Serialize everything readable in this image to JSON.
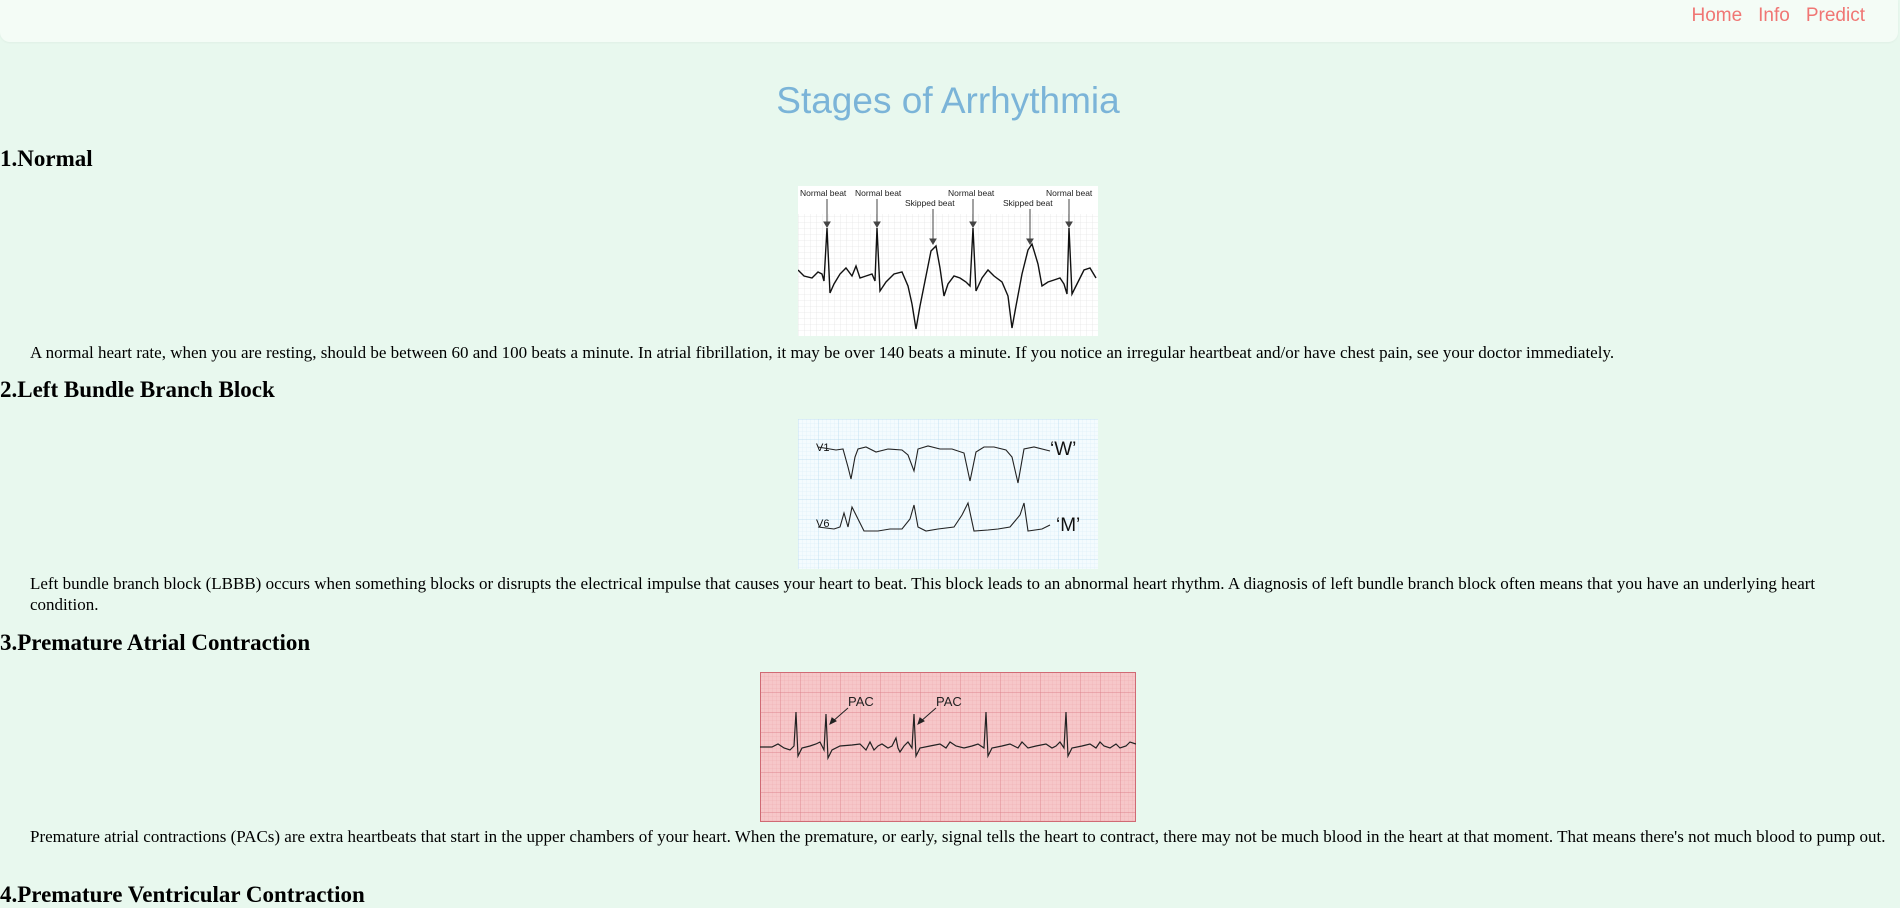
{
  "nav": {
    "items": [
      "Home",
      "Info",
      "Predict"
    ],
    "link_color": "#f07674"
  },
  "page": {
    "title": "Stages of Arrhythmia",
    "title_color": "#7bb4d8",
    "background": "#e8f8ee"
  },
  "sections": [
    {
      "heading": "1.Normal",
      "image_labels": [
        "Normal beat",
        "Normal beat",
        "Skipped beat",
        "Normal beat",
        "Skipped beat",
        "Normal beat"
      ],
      "text": "A normal heart rate, when you are resting, should be between 60 and 100 beats a minute. In atrial fibrillation, it may be over 140 beats a minute. If you notice an irregular heartbeat and/or have chest pain, see your doctor immediately."
    },
    {
      "heading": "2.Left Bundle Branch Block",
      "image_labels": [
        "V1",
        "V6",
        "‘W’",
        "‘M’"
      ],
      "text": "Left bundle branch block (LBBB) occurs when something blocks or disrupts the electrical impulse that causes your heart to beat. This block leads to an abnormal heart rhythm. A diagnosis of left bundle branch block often means that you have an underlying heart condition."
    },
    {
      "heading": "3.Premature Atrial Contraction",
      "image_labels": [
        "PAC",
        "PAC"
      ],
      "text": "Premature atrial contractions (PACs) are extra heartbeats that start in the upper chambers of your heart. When the premature, or early, signal tells the heart to contract, there may not be much blood in the heart at that moment. That means there's not much blood to pump out."
    },
    {
      "heading": "4.Premature Ventricular Contraction"
    }
  ]
}
